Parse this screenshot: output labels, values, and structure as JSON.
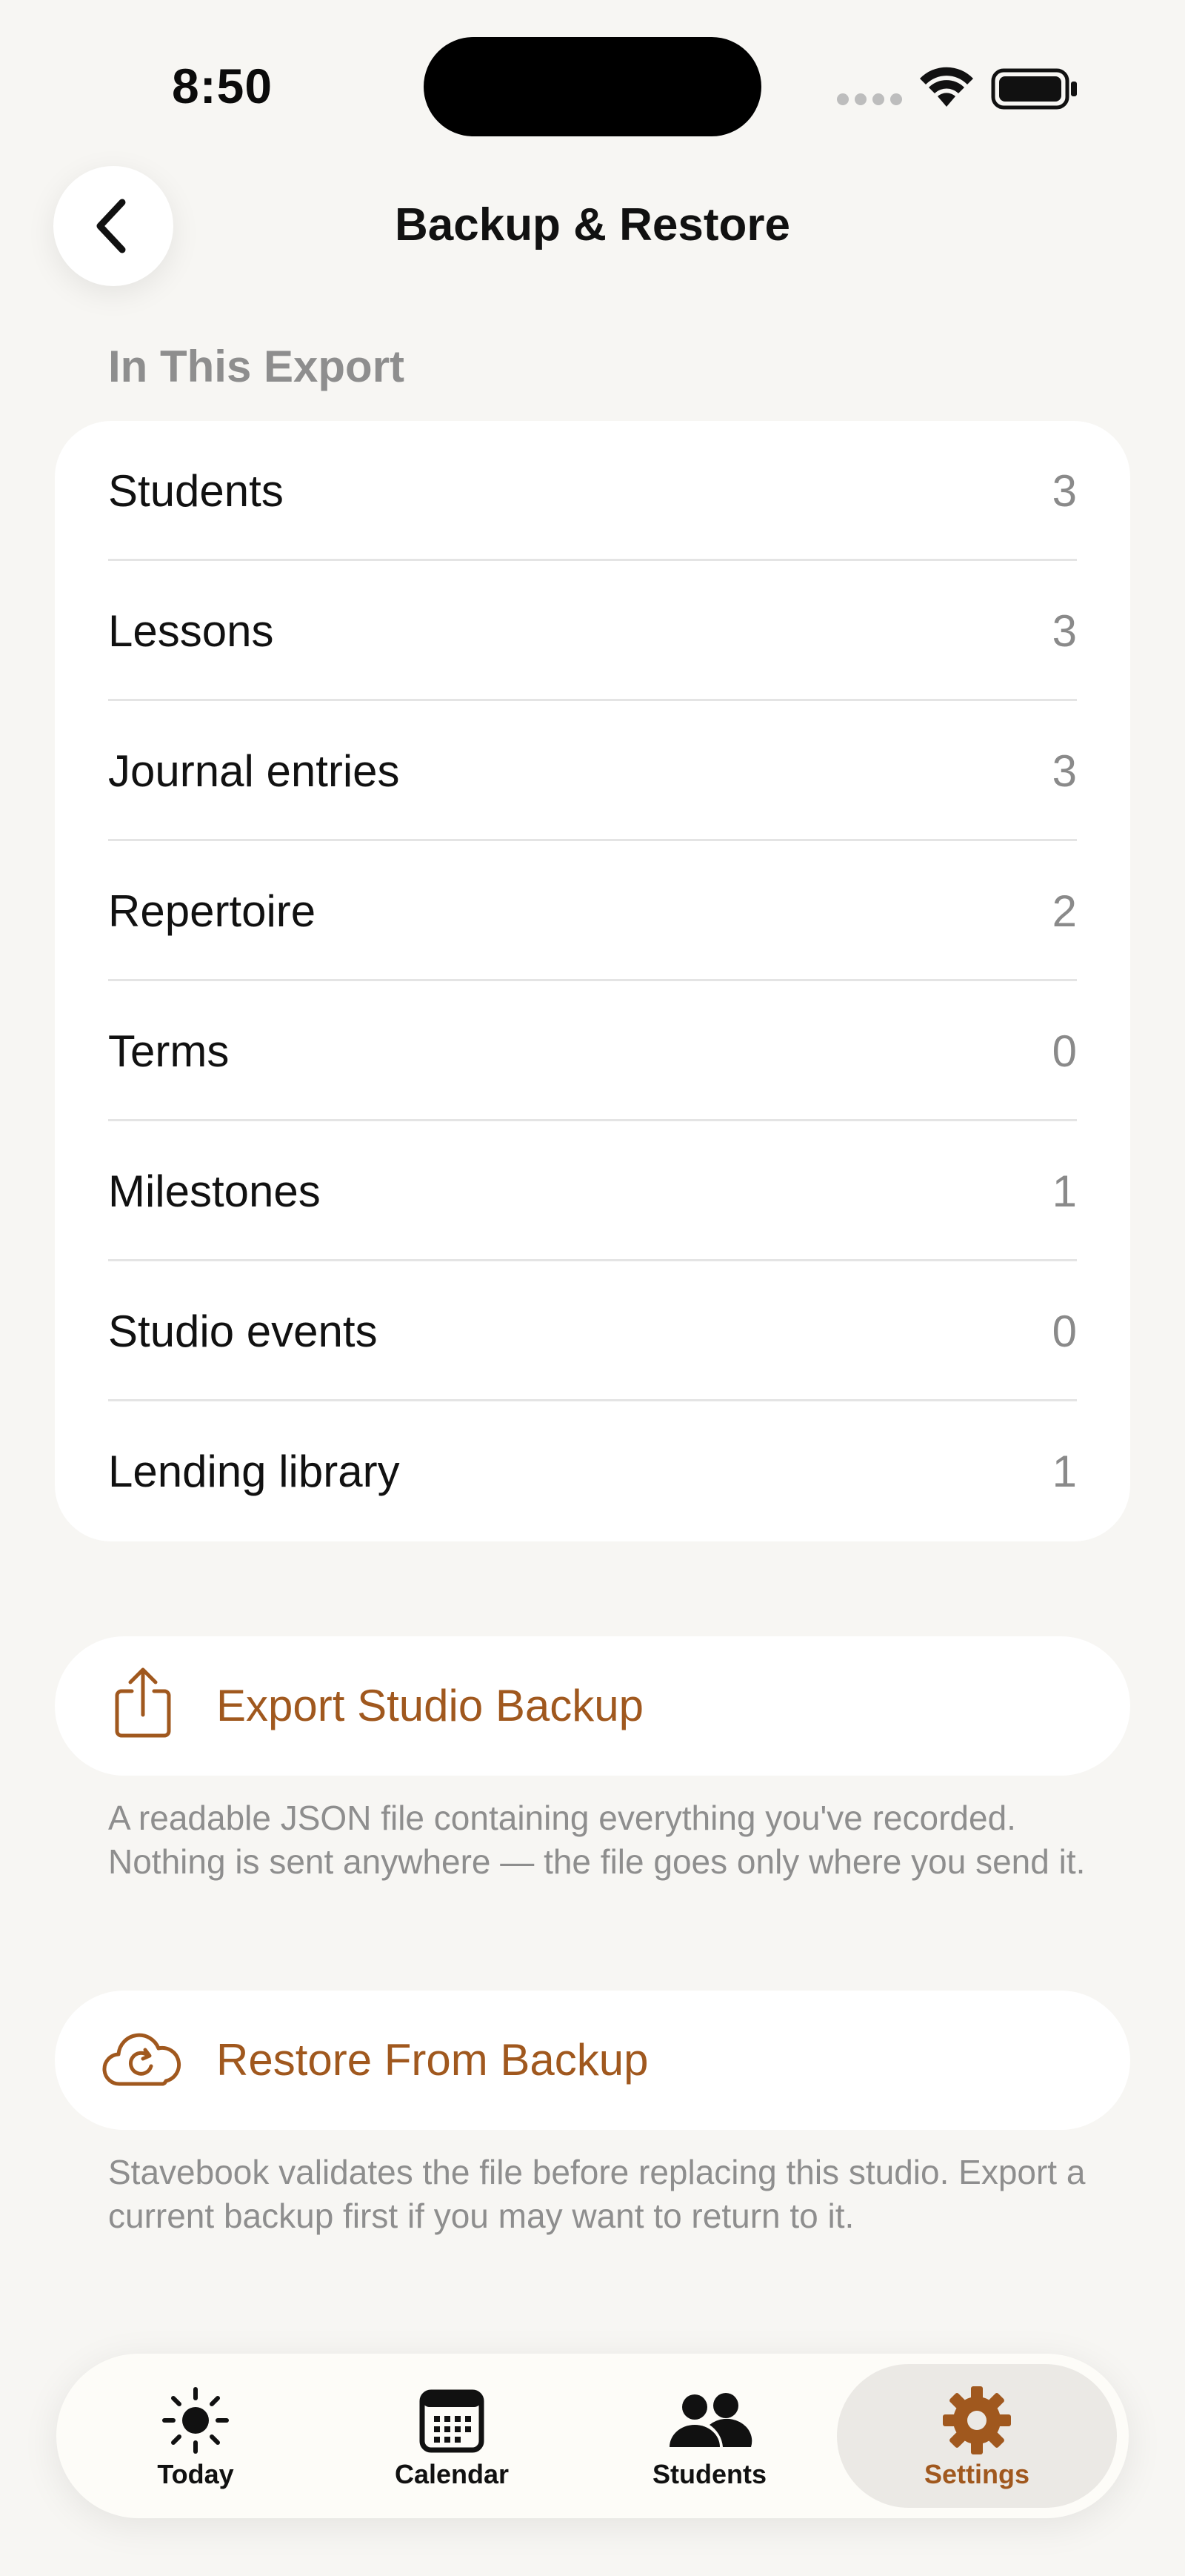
{
  "status_bar": {
    "time": "8:50"
  },
  "header": {
    "title": "Backup & Restore"
  },
  "export_section": {
    "header": "In This Export",
    "rows": [
      {
        "label": "Students",
        "count": "3"
      },
      {
        "label": "Lessons",
        "count": "3"
      },
      {
        "label": "Journal entries",
        "count": "3"
      },
      {
        "label": "Repertoire",
        "count": "2"
      },
      {
        "label": "Terms",
        "count": "0"
      },
      {
        "label": "Milestones",
        "count": "1"
      },
      {
        "label": "Studio events",
        "count": "0"
      },
      {
        "label": "Lending library",
        "count": "1"
      }
    ]
  },
  "export_action": {
    "label": "Export Studio Backup",
    "icon": "share-icon",
    "footnote": "A readable JSON file containing everything you've recorded. Nothing is sent anywhere — the file goes only where you send it."
  },
  "restore_action": {
    "label": "Restore From Backup",
    "icon": "cloud-restore-icon",
    "footnote": "Stavebook validates the file before replacing this studio. Export a current backup first if you may want to return to it."
  },
  "tab_bar": {
    "active": "Settings",
    "tabs": [
      {
        "label": "Today",
        "icon": "sun-icon"
      },
      {
        "label": "Calendar",
        "icon": "calendar-icon"
      },
      {
        "label": "Students",
        "icon": "people-icon"
      },
      {
        "label": "Settings",
        "icon": "gear-icon"
      }
    ]
  },
  "colors": {
    "accent": "#a0581e",
    "background": "#f7f6f3",
    "card": "#ffffff",
    "secondary_text": "#8e8e8e"
  }
}
